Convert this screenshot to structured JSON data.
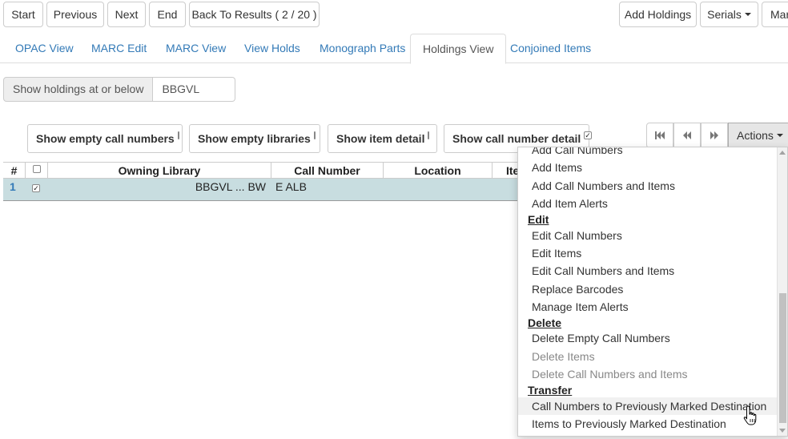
{
  "nav": {
    "start": "Start",
    "previous": "Previous",
    "next": "Next",
    "end": "End",
    "back_to_results": "Back To Results ( 2 / 20 )",
    "add_holdings": "Add Holdings",
    "serials": "Serials",
    "mark": "Mar"
  },
  "tabs": [
    {
      "label": "OPAC View"
    },
    {
      "label": "MARC Edit"
    },
    {
      "label": "MARC View"
    },
    {
      "label": "View Holds"
    },
    {
      "label": "Monograph Parts"
    },
    {
      "label": "Holdings View",
      "active": true
    },
    {
      "label": "Conjoined Items"
    }
  ],
  "holdings_filter": {
    "label": "Show holdings at or below",
    "value": "BBGVL"
  },
  "options": {
    "empty_call_numbers": {
      "label": "Show empty call numbers",
      "checked": false
    },
    "empty_libraries": {
      "label": "Show empty libraries",
      "checked": false
    },
    "item_detail": {
      "label": "Show item detail",
      "checked": false
    },
    "call_number_detail": {
      "label": "Show call number detail",
      "checked": true
    }
  },
  "actions": {
    "label": "Actions"
  },
  "grid": {
    "headers": {
      "num": "#",
      "owning_library": "Owning Library",
      "call_number": "Call Number",
      "location": "Location",
      "item": "Ite"
    },
    "rows": [
      {
        "num": "1",
        "owning_library": "BBGVL ... BW",
        "call_number": "E ALB",
        "checked": true
      }
    ]
  },
  "menu": {
    "add_items_cut": "Add Call Numbers",
    "add_items": "Add Items",
    "add_call_numbers_and_items": "Add Call Numbers and Items",
    "add_item_alerts": "Add Item Alerts",
    "edit_header": "Edit",
    "edit_call_numbers": "Edit Call Numbers",
    "edit_items": "Edit Items",
    "edit_call_numbers_and_items": "Edit Call Numbers and Items",
    "replace_barcodes": "Replace Barcodes",
    "manage_item_alerts": "Manage Item Alerts",
    "delete_header": "Delete",
    "delete_empty_call_numbers": "Delete Empty Call Numbers",
    "delete_items": "Delete Items",
    "delete_call_numbers_and_items": "Delete Call Numbers and Items",
    "transfer_header": "Transfer",
    "transfer_call_numbers": "Call Numbers to Previously Marked Destination",
    "transfer_items": "Items to Previously Marked Destination"
  }
}
